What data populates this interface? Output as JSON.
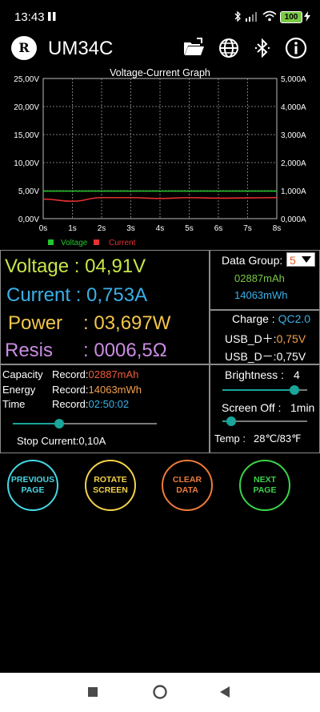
{
  "status_bar": {
    "time": "13:43",
    "battery": "100"
  },
  "app": {
    "logo_text": "R",
    "title": "UM34C"
  },
  "chart_data": {
    "type": "line",
    "title": "Voltage-Current Graph",
    "x": [
      "0s",
      "1s",
      "2s",
      "3s",
      "4s",
      "5s",
      "6s",
      "7s",
      "8s"
    ],
    "y_left_ticks": [
      "25,00V",
      "20,00V",
      "15,00V",
      "10,00V",
      "5,00V",
      "0,00V"
    ],
    "y_right_ticks": [
      "5,000A",
      "4,000A",
      "3,000A",
      "2,000A",
      "1,000A",
      "0,000A"
    ],
    "ylim_left": [
      0,
      25
    ],
    "ylim_right": [
      0,
      5
    ],
    "grid": true,
    "legend_position": "bottom-left",
    "series": [
      {
        "name": "Voltage",
        "axis": "left",
        "color": "#22c62a",
        "values": [
          4.91,
          4.91,
          4.91,
          4.91,
          4.91,
          4.91,
          4.91,
          4.91,
          4.91
        ]
      },
      {
        "name": "Current",
        "axis": "right",
        "color": "#e53030",
        "values": [
          0.7,
          0.62,
          0.75,
          0.75,
          0.72,
          0.75,
          0.73,
          0.74,
          0.753
        ]
      }
    ]
  },
  "meter": {
    "voltage_label": "Voltage : ",
    "voltage_value": "04,91V",
    "current_label": "Current : ",
    "current_value": "0,753A",
    "power_label": "Power",
    "power_sep": ": ",
    "power_value": "03,697W",
    "resis_label": "Resis",
    "resis_sep": ": ",
    "resis_value": "0006,5Ω"
  },
  "group": {
    "label": "Data Group:",
    "selected": "5",
    "mah": "02887mAh",
    "mwh": "14063mWh"
  },
  "charge": {
    "label": "Charge : ",
    "mode": "QC2.0",
    "dplus_label": "USB_D＋:",
    "dplus_value": "0,75V",
    "dminus_label": "USB_D－:",
    "dminus_value": "0,75V"
  },
  "records": {
    "capacity_label": "Capacity",
    "capacity_rec": "Record:",
    "capacity_value": "02887mAh",
    "energy_label": "Energy",
    "energy_rec": "Record:",
    "energy_value": "14063mWh",
    "time_label": "Time",
    "time_rec": "Record:",
    "time_value": "02:50:02",
    "stop_current_label": "Stop Current:",
    "stop_current_value": "0,10A",
    "stop_current_slider": 0.32
  },
  "settings": {
    "brightness_label": "Brightness :",
    "brightness_value": "4",
    "brightness_slider": 0.85,
    "screen_off_label": "Screen Off :",
    "screen_off_value": "1min",
    "screen_off_slider": 0.1,
    "temp_label": "Temp :",
    "temp_value": "28℃/83℉"
  },
  "buttons": {
    "previous": [
      "PREVIOUS",
      "PAGE"
    ],
    "rotate": [
      "ROTATE",
      "SCREEN"
    ],
    "clear": [
      "CLEAR",
      "DATA"
    ],
    "next": [
      "NEXT",
      "PAGE"
    ]
  },
  "colors": {
    "voltage": "#c7e64a",
    "current": "#3ab0e8",
    "power": "#f4c64b",
    "resis": "#c98ce0",
    "green_text": "#7ac943",
    "blue_text": "#3ab0e8",
    "orange": "#f5a14a",
    "red_orange": "#f05a3c",
    "btn_prev": "#45d8e6",
    "btn_rotate": "#f4d24a",
    "btn_clear": "#f07a3a",
    "btn_next": "#3ad34a"
  }
}
